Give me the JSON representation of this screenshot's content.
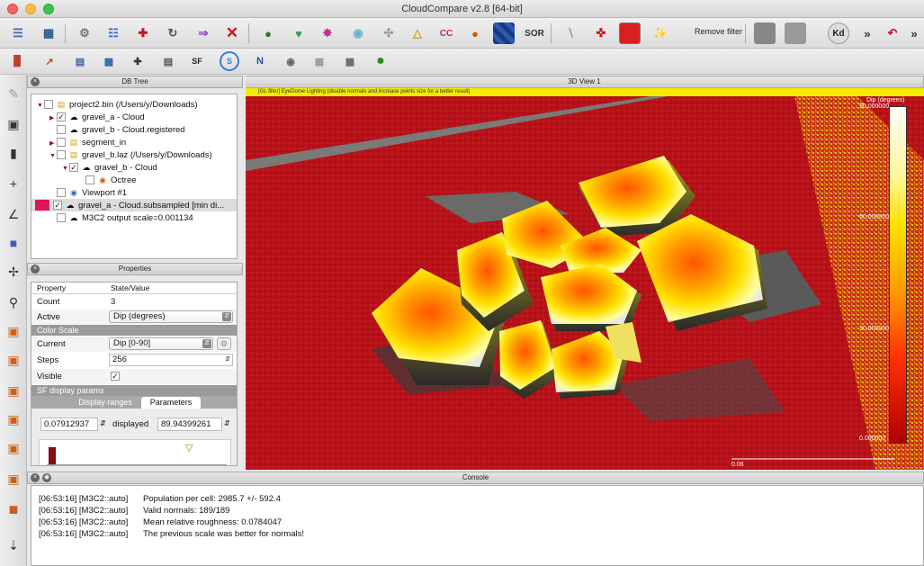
{
  "window": {
    "title": "CloudCompare v2.8 [64-bit]"
  },
  "toolbar_main": {
    "icons": [
      "open-icon",
      "save-icon",
      "settings-icon",
      "list-icon",
      "translate-icon",
      "clone-icon",
      "merge-icon",
      "delete-icon",
      "sample-icon",
      "sf-icon",
      "noise-icon",
      "normal-icon",
      "filter-icon",
      "smooth-icon",
      "cc-icon",
      "blob-icon",
      "grid-icon",
      "sor-icon",
      "track-icon",
      "crosshair-icon",
      "cube-icon",
      "sparkle-icon"
    ],
    "remove_filter_label": "Remove filter",
    "sor_label": "SOR",
    "kd_label": "Kd"
  },
  "toolbar_second": {
    "sf_label": "SF",
    "n_label": "N"
  },
  "db_tree": {
    "title": "DB Tree",
    "items": [
      {
        "label": "project2.bin (/Users/y/Downloads)"
      },
      {
        "label": "gravel_a - Cloud"
      },
      {
        "label": "gravel_b - Cloud.registered"
      },
      {
        "label": "segment_in"
      },
      {
        "label": "gravel_b.laz (/Users/y/Downloads)"
      },
      {
        "label": "gravel_b - Cloud"
      },
      {
        "label": "Octree"
      },
      {
        "label": "Viewport #1"
      },
      {
        "label": "gravel_a - Cloud.subsampled [min di..."
      },
      {
        "label": "M3C2 output scale=0.001134"
      }
    ]
  },
  "properties": {
    "title": "Properties",
    "header": {
      "property": "Property",
      "value": "State/Value"
    },
    "count_label": "Count",
    "count_value": "3",
    "active_label": "Active",
    "active_value": "Dip (degrees)",
    "color_scale_section": "Color Scale",
    "current_label": "Current",
    "current_value": "Dip [0-90]",
    "steps_label": "Steps",
    "steps_value": "256",
    "visible_label": "Visible",
    "visible_checked": "✓",
    "sf_section": "SF display params",
    "tab_ranges": "Display ranges",
    "tab_params": "Parameters",
    "range_min": "0.07912937",
    "displayed_label": "displayed",
    "range_max": "89.94399261"
  },
  "view3d": {
    "title": "3D View 1",
    "banner": "[GL filter] EyeDome Lighting (disable normals and increase points size for a better result)",
    "scale_title": "Dip (degrees)",
    "scale_labels": [
      "90.000000",
      "60.000000",
      "30.000000",
      "0.000000"
    ],
    "distance_label": "0.06"
  },
  "console": {
    "title": "Console",
    "lines": [
      {
        "ts": "[06:53:16] [M3C2::auto]",
        "msg": "Population per cell: 2985.7 +/- 592.4"
      },
      {
        "ts": "[06:53:16] [M3C2::auto]",
        "msg": "Valid normals: 189/189"
      },
      {
        "ts": "[06:53:16] [M3C2::auto]",
        "msg": "Mean relative roughness: 0.0784047"
      },
      {
        "ts": "[06:53:16] [M3C2::auto]",
        "msg": "The previous scale was better for normals!"
      }
    ]
  },
  "colors": {
    "accent": "#b7111a",
    "selection": "#e0155f",
    "banner": "#f2ea00"
  }
}
